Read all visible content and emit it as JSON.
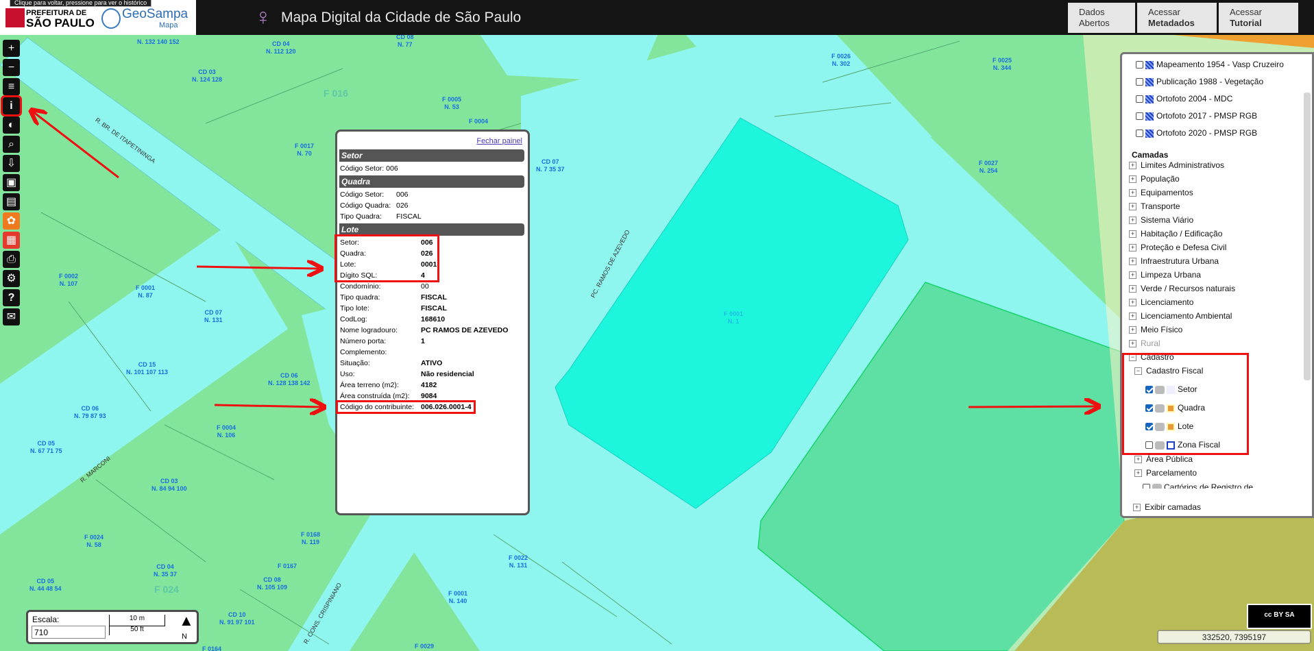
{
  "header": {
    "tooltip": "Clique para voltar, pressione para ver o histórico",
    "prefeitura_line1": "PREFEITURA DE",
    "prefeitura_line2": "SÃO PAULO",
    "geosampa": "GeoSampa",
    "geosampa_sub": "Mapa",
    "title": "Mapa Digital da Cidade de São Paulo",
    "buttons": [
      {
        "line1": "Dados",
        "line2": "Abertos"
      },
      {
        "line1": "Acessar",
        "line2": "Metadados"
      },
      {
        "line1": "Acessar",
        "line2": "Tutorial"
      }
    ]
  },
  "toolbar": {
    "zoom_in": "+",
    "zoom_out": "−",
    "info": "i",
    "help": "?"
  },
  "info_panel": {
    "close_label": "Fechar painel",
    "setor_head": "Setor",
    "setor_code_label": "Código Setor:",
    "setor_code": "006",
    "quadra_head": "Quadra",
    "quadra_rows": [
      {
        "k": "Código Setor:",
        "v": "006"
      },
      {
        "k": "Código Quadra:",
        "v": "026"
      },
      {
        "k": "Tipo Quadra:",
        "v": "FISCAL"
      }
    ],
    "lote_head": "Lote",
    "lote_rows": [
      {
        "k": "Setor:",
        "v": "006"
      },
      {
        "k": "Quadra:",
        "v": "026"
      },
      {
        "k": "Lote:",
        "v": "0001"
      },
      {
        "k": "Dígito SQL:",
        "v": "4"
      },
      {
        "k": "Condomínio:",
        "v": "00"
      },
      {
        "k": "Tipo quadra:",
        "v": "FISCAL"
      },
      {
        "k": "Tipo lote:",
        "v": "FISCAL"
      },
      {
        "k": "CodLog:",
        "v": "168610"
      },
      {
        "k": "Nome logradouro:",
        "v": "PC RAMOS DE AZEVEDO"
      },
      {
        "k": "Número porta:",
        "v": "1"
      },
      {
        "k": "Complemento:",
        "v": ""
      },
      {
        "k": "Situação:",
        "v": "ATIVO"
      },
      {
        "k": "Uso:",
        "v": "Não residencial"
      },
      {
        "k": "Área terreno (m2):",
        "v": "4182"
      },
      {
        "k": "Área construída (m2):",
        "v": "9084"
      },
      {
        "k": "Código do contribuinte:",
        "v": "006.026.0001-4"
      }
    ]
  },
  "layers": {
    "basemaps": [
      "Mapeamento 1954 - Vasp Cruzeiro",
      "Publicação 1988 - Vegetação",
      "Ortofoto 2004 - MDC",
      "Ortofoto 2017 - PMSP RGB",
      "Ortofoto 2020 - PMSP RGB"
    ],
    "camadas_title": "Camadas",
    "groups": [
      "Limites Administrativos",
      "População",
      "Equipamentos",
      "Transporte",
      "Sistema Viário",
      "Habitação / Edificação",
      "Proteção e Defesa Civil",
      "Infraestrutura Urbana",
      "Limpeza Urbana",
      "Verde / Recursos naturais",
      "Licenciamento",
      "Licenciamento Ambiental",
      "Meio Físico",
      "Rural"
    ],
    "cadastro": "Cadastro",
    "cadastro_fiscal": "Cadastro Fiscal",
    "fiscal_layers": [
      {
        "label": "Setor",
        "checked": true
      },
      {
        "label": "Quadra",
        "checked": true
      },
      {
        "label": "Lote",
        "checked": true
      },
      {
        "label": "Zona Fiscal",
        "checked": false
      }
    ],
    "area_publica": "Área Pública",
    "parcelamento": "Parcelamento",
    "cartorios": "Cartórios de Registro de",
    "exibir": "Exibir camadas"
  },
  "scale": {
    "label": "Escala:",
    "value": "710",
    "bar_m": "10 m",
    "bar_ft": "50 ft",
    "north": "N"
  },
  "coords": "332520, 7395197",
  "license": "cc  BY  SA",
  "map_labels": [
    {
      "t": "N. 132 140 152"
    },
    {
      "t": "CD 04\nN. 112 120"
    },
    {
      "t": "CD 08\nN. 77"
    },
    {
      "t": "CD 03\nN. 124 128"
    },
    {
      "t": "F 0005\nN. 53"
    },
    {
      "t": "F 0004"
    },
    {
      "t": "F 0017\nN. 70"
    },
    {
      "t": "CD 07\nN. 7 35 37"
    },
    {
      "t": "F 0002\nN. 107"
    },
    {
      "t": "F 0001\nN. 87"
    },
    {
      "t": "CD 07\nN. 131"
    },
    {
      "t": "CD 15\nN. 101 107 113"
    },
    {
      "t": "CD 06\nN. 128 138 142"
    },
    {
      "t": "CD 06\nN. 79 87 93"
    },
    {
      "t": "CD 05\nN. 67 71 75"
    },
    {
      "t": "F 0004\nN. 106"
    },
    {
      "t": "CD 03\nN. 84 94 100"
    },
    {
      "t": "F 0024\nN. 58"
    },
    {
      "t": "F 0168\nN. 119"
    },
    {
      "t": "F 0167"
    },
    {
      "t": "CD 04\nN. 35 37"
    },
    {
      "t": "CD 08\nN. 105 109"
    },
    {
      "t": "CD 05\nN. 44 48 54"
    },
    {
      "t": "CD 10\nN. 91 97 101"
    },
    {
      "t": "F 0022\nN. 131"
    },
    {
      "t": "F 0001\nN. 140"
    },
    {
      "t": "F 0029"
    },
    {
      "t": "F 0164"
    },
    {
      "t": "F 0026\nN. 302"
    },
    {
      "t": "F 0025\nN. 344"
    },
    {
      "t": "F 0027\nN. 254"
    },
    {
      "t": "F 0001\nN. 1"
    }
  ],
  "block_labels": [
    "F 016",
    "F 024"
  ],
  "street_names": [
    "R. BR. DE ITAPETININGA",
    "PC. RAMOS DE AZEVEDO",
    "R. MARCONI",
    "R. CONS. CRISPINIANO"
  ]
}
